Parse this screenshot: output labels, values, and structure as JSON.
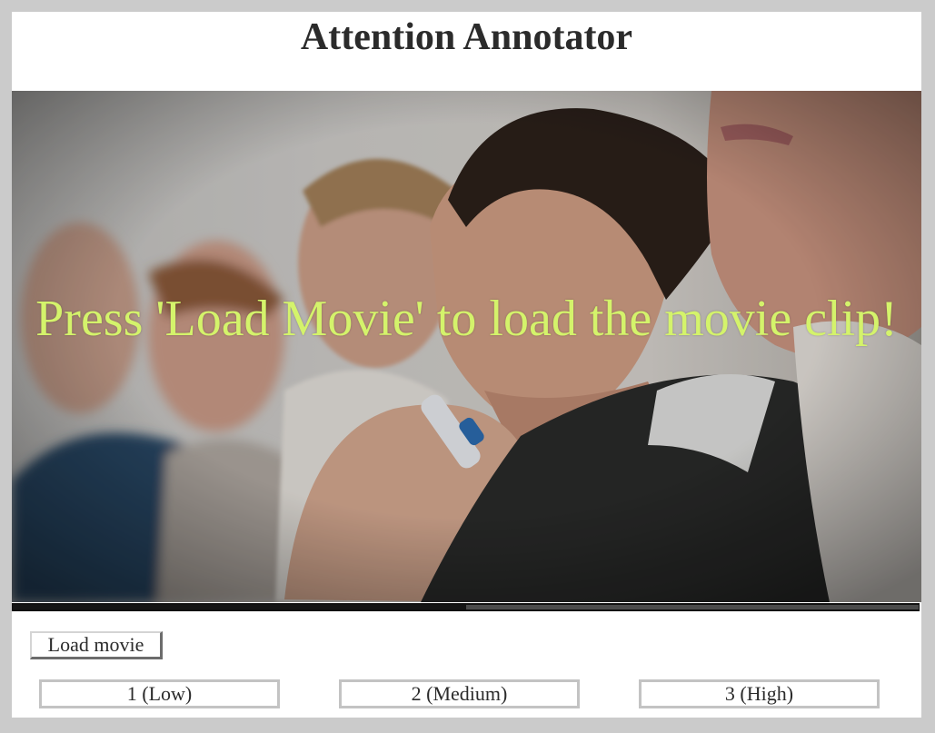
{
  "app": {
    "title": "Attention Annotator"
  },
  "video": {
    "message": "Press 'Load Movie' to load the movie clip!",
    "progress": 0.5
  },
  "controls": {
    "load_label": "Load movie",
    "ratings": [
      {
        "label": "1 (Low)"
      },
      {
        "label": "2 (Medium)"
      },
      {
        "label": "3 (High)"
      }
    ]
  },
  "colors": {
    "message_text": "#d4f36b",
    "page_background": "#cbcbcb",
    "panel_background": "#ffffff"
  }
}
